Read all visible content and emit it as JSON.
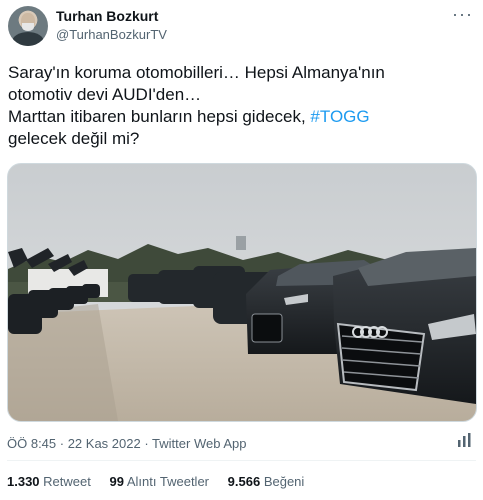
{
  "author": {
    "name": "Turhan Bozkurt",
    "handle": "@TurhanBozkurTV"
  },
  "more_icon": "more-horizontal-icon",
  "tweet": {
    "line1": "Saray'ın koruma otomobilleri… Hepsi Almanya'nın",
    "line2": "otomotiv devi AUDI'den…",
    "line3_text": "Marttan itibaren bunların hepsi gidecek, ",
    "line3_hashtag": "#TOGG",
    "line4": "gelecek değil mi?"
  },
  "meta": {
    "time": "ÖÖ 8:45",
    "sep1": " · ",
    "date": "22 Kas 2022",
    "sep2": " · ",
    "app": "Twitter Web App"
  },
  "analytics_icon": "analytics-icon",
  "stats": {
    "retweets_count": "1.330",
    "retweets_label": "Retweet",
    "quotes_count": "99",
    "quotes_label": "Alıntı Tweetler",
    "likes_count": "9.566",
    "likes_label": "Beğeni"
  },
  "colors": {
    "link": "#1d9bf0",
    "secondary_text": "#536471",
    "primary_text": "#0f1419"
  }
}
